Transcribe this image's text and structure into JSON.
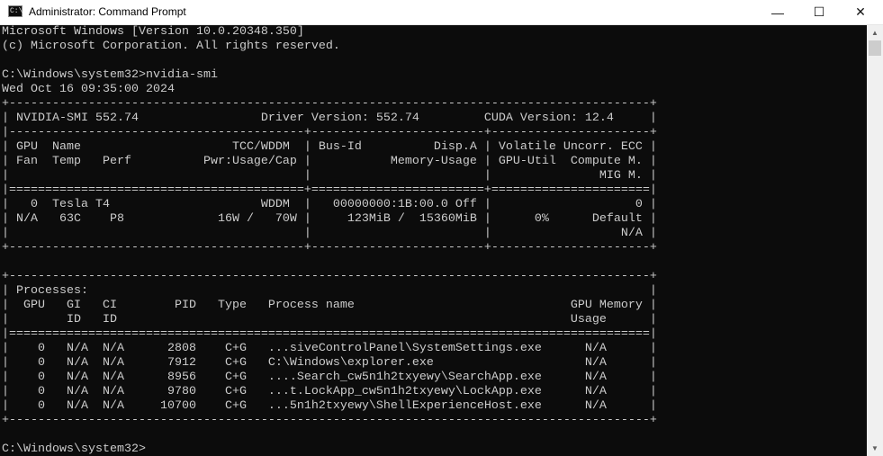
{
  "window": {
    "title": "Administrator: Command Prompt",
    "icon_label": "C:\\",
    "minimize": "—",
    "maximize": "☐",
    "close": "✕"
  },
  "console": {
    "lines": [
      "Microsoft Windows [Version 10.0.20348.350]",
      "(c) Microsoft Corporation. All rights reserved.",
      "",
      "C:\\Windows\\system32>nvidia-smi",
      "Wed Oct 16 09:35:00 2024",
      "+-----------------------------------------------------------------------------------------+",
      "| NVIDIA-SMI 552.74                 Driver Version: 552.74         CUDA Version: 12.4     |",
      "|-----------------------------------------+------------------------+----------------------+",
      "| GPU  Name                     TCC/WDDM  | Bus-Id          Disp.A | Volatile Uncorr. ECC |",
      "| Fan  Temp   Perf          Pwr:Usage/Cap |           Memory-Usage | GPU-Util  Compute M. |",
      "|                                         |                        |               MIG M. |",
      "|=========================================+========================+======================|",
      "|   0  Tesla T4                     WDDM  |   00000000:1B:00.0 Off |                    0 |",
      "| N/A   63C    P8             16W /   70W |     123MiB /  15360MiB |      0%      Default |",
      "|                                         |                        |                  N/A |",
      "+-----------------------------------------+------------------------+----------------------+",
      "",
      "+-----------------------------------------------------------------------------------------+",
      "| Processes:                                                                              |",
      "|  GPU   GI   CI        PID   Type   Process name                              GPU Memory |",
      "|        ID   ID                                                               Usage      |",
      "|=========================================================================================|",
      "|    0   N/A  N/A      2808    C+G   ...siveControlPanel\\SystemSettings.exe      N/A      |",
      "|    0   N/A  N/A      7912    C+G   C:\\Windows\\explorer.exe                     N/A      |",
      "|    0   N/A  N/A      8956    C+G   ....Search_cw5n1h2txyewy\\SearchApp.exe      N/A      |",
      "|    0   N/A  N/A      9780    C+G   ...t.LockApp_cw5n1h2txyewy\\LockApp.exe      N/A      |",
      "|    0   N/A  N/A     10700    C+G   ...5n1h2txyewy\\ShellExperienceHost.exe      N/A      |",
      "+-----------------------------------------------------------------------------------------+",
      "",
      "C:\\Windows\\system32>"
    ]
  },
  "scrollbar": {
    "up": "▲",
    "down": "▼"
  }
}
